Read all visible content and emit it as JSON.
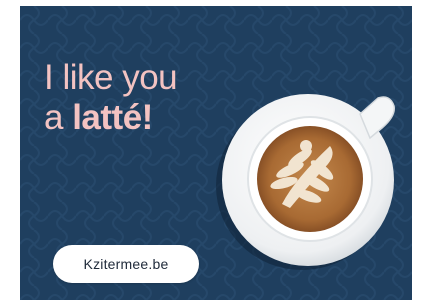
{
  "headline": {
    "line1": "I like you",
    "line2_prefix": "a ",
    "line2_emphasis": "latté!"
  },
  "cta": {
    "label": "Kzitermee.be"
  },
  "colors": {
    "background": "#1f3f5f",
    "headline_text": "#f3c3c2",
    "button_bg": "#ffffff",
    "button_text": "#1f2a3a"
  },
  "illustration": {
    "icon": "latte-cup-icon"
  }
}
